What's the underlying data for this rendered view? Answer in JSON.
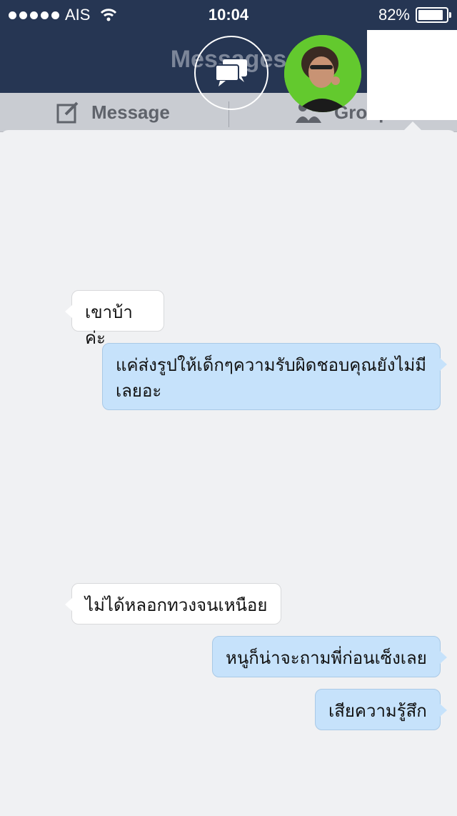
{
  "status_bar": {
    "carrier": "AIS",
    "time": "10:04",
    "battery": "82%",
    "battery_level": 0.82
  },
  "nav": {
    "title": "Messages"
  },
  "tabs": [
    {
      "label": "Message",
      "icon": "compose-icon"
    },
    {
      "label": "Group",
      "icon": "group-icon"
    }
  ],
  "chat_heads": [
    {
      "icon": "chat-bubbles-icon"
    },
    {
      "icon": "avatar"
    }
  ],
  "messages": [
    {
      "direction": "incoming",
      "text": "เขาบ้าค่ะ"
    },
    {
      "direction": "outgoing",
      "text": "แค่ส่งรูปให้เด็กๆความรับผิดชอบคุณยังไม่มีเลยอะ"
    },
    {
      "direction": "incoming",
      "text": "ไม่ได้หลอกทวงจนเหนือย"
    },
    {
      "direction": "outgoing",
      "text": "หนูก็น่าจะถามพี่ก่อนเซ็งเลย"
    },
    {
      "direction": "outgoing",
      "text": "เสียความรู้สึก"
    }
  ],
  "colors": {
    "nav_bg": "#263653",
    "incoming_bubble": "#ffffff",
    "outgoing_bubble": "#c6e2fb",
    "avatar_bg": "#63c92e"
  }
}
